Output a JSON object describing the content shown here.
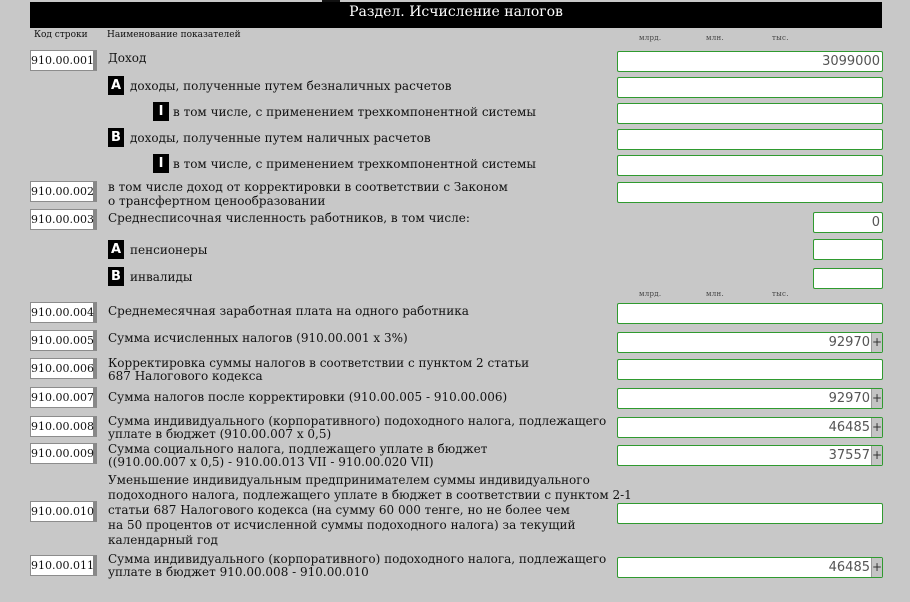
{
  "section": {
    "title": "Раздел. Исчисление налогов"
  },
  "headers": {
    "code": "Код строки",
    "name": "Наименование показателей"
  },
  "units": {
    "bln": "млрд.",
    "mln": "млн.",
    "ths": "тыс."
  },
  "badges": {
    "a": "A",
    "b": "B",
    "i": "I"
  },
  "plus": "+",
  "rows": {
    "r001": {
      "code": "910.00.001",
      "label": "Доход",
      "value": "3099000"
    },
    "r001a": {
      "label": "доходы, полученные путем безналичных расчетов",
      "value": ""
    },
    "r001a1": {
      "label": "в том числе, с применением трехкомпонентной системы",
      "value": ""
    },
    "r001b": {
      "label": "доходы, полученные путем наличных расчетов",
      "value": ""
    },
    "r001b1": {
      "label": "в том числе, с применением трехкомпонентной системы",
      "value": ""
    },
    "r002": {
      "code": "910.00.002",
      "label1": "в том числе доход от корректировки в соответствии с Законом",
      "label2": "о трансфертном ценообразовании",
      "value": ""
    },
    "r003": {
      "code": "910.00.003",
      "label": "Среднесписочная численность работников, в том числе:",
      "value": "0"
    },
    "r003a": {
      "label": "пенсионеры",
      "value": ""
    },
    "r003b": {
      "label": "инвалиды",
      "value": ""
    },
    "r004": {
      "code": "910.00.004",
      "label": "Среднемесячная заработная плата на одного работника",
      "value": ""
    },
    "r005": {
      "code": "910.00.005",
      "label": "Сумма исчисленных налогов (910.00.001 x 3%)",
      "value": "92970"
    },
    "r006": {
      "code": "910.00.006",
      "label1": "Корректировка суммы налогов в соответствии с пунктом 2 статьи",
      "label2": "687 Налогового кодекса",
      "value": ""
    },
    "r007": {
      "code": "910.00.007",
      "label": "Сумма налогов после корректировки (910.00.005 - 910.00.006)",
      "value": "92970"
    },
    "r008": {
      "code": "910.00.008",
      "label1": "Сумма индивидуального (корпоративного) подоходного налога, подлежащего",
      "label2": "уплате в бюджет (910.00.007 x 0,5)",
      "value": "46485"
    },
    "r009": {
      "code": "910.00.009",
      "label1": "Сумма социального налога, подлежащего уплате в бюджет",
      "label2": "((910.00.007 x 0,5) - 910.00.013 VII - 910.00.020 VII)",
      "value": "37557"
    },
    "r010": {
      "code": "910.00.010",
      "label1": "Уменьшение индивидуальным предпринимателем суммы индивидуального",
      "label2": "подоходного налога, подлежащего уплате в бюджет в соответствии с пунктом 2-1",
      "label3": "статьи 687 Налогового кодекса (на сумму 60 000 тенге, но не более чем",
      "label4": "на 50 процентов от исчисленной суммы подоходного налога) за текущий",
      "label5": "календарный год",
      "value": ""
    },
    "r011": {
      "code": "910.00.011",
      "label1": "Сумма индивидуального (корпоративного) подоходного налога, подлежащего",
      "label2": "уплате в бюджет 910.00.008 - 910.00.010",
      "value": "46485"
    }
  }
}
